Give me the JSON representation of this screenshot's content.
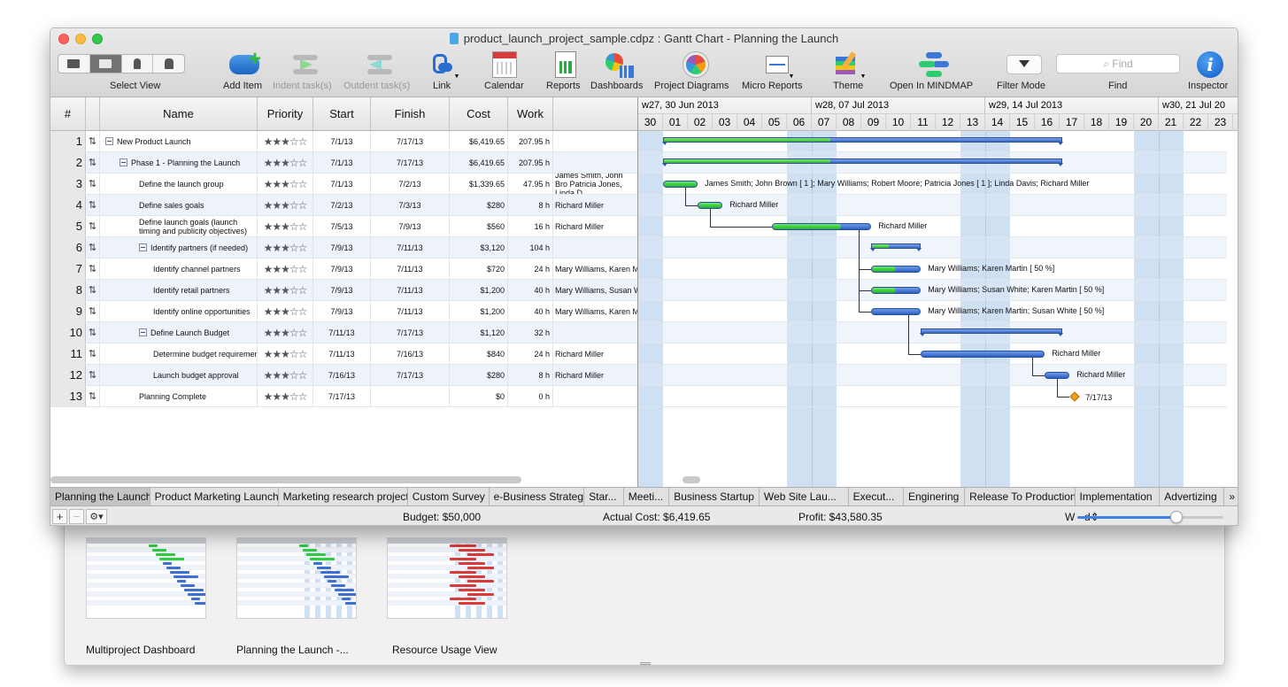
{
  "window": {
    "title": "product_launch_project_sample.cdpz : Gantt Chart - Planning the Launch"
  },
  "toolbar": {
    "select_view": "Select View",
    "add_item": "Add Item",
    "indent": "Indent task(s)",
    "outdent": "Outdent task(s)",
    "link": "Link",
    "calendar": "Calendar",
    "reports": "Reports",
    "dashboards": "Dashboards",
    "project_diagrams": "Project Diagrams",
    "micro_reports": "Micro Reports",
    "theme": "Theme",
    "open_mindmap": "Open In MINDMAP",
    "filter_mode": "Filter Mode",
    "find": "Find",
    "find_placeholder": "Find",
    "inspector": "Inspector"
  },
  "table": {
    "headers": {
      "num": "#",
      "name": "Name",
      "priority": "Priority",
      "start": "Start",
      "finish": "Finish",
      "cost": "Cost",
      "work": "Work"
    },
    "rows": [
      {
        "num": "1",
        "name": "New Product Launch",
        "level": 0,
        "group": true,
        "stars": "★★★☆☆",
        "start": "7/1/13",
        "finish": "7/17/13",
        "cost": "$6,419.65",
        "work": "207.95 h",
        "resource": ""
      },
      {
        "num": "2",
        "name": "Phase 1 - Planning the Launch",
        "level": 1,
        "group": true,
        "stars": "★★★☆☆",
        "start": "7/1/13",
        "finish": "7/17/13",
        "cost": "$6,419.65",
        "work": "207.95 h",
        "resource": ""
      },
      {
        "num": "3",
        "name": "Define the launch group",
        "level": 2,
        "group": false,
        "stars": "★★★☆☆",
        "start": "7/1/13",
        "finish": "7/2/13",
        "cost": "$1,339.65",
        "work": "47.95 h",
        "resource": "James Smith, John Bro Patricia Jones, Linda D"
      },
      {
        "num": "4",
        "name": "Define sales goals",
        "level": 2,
        "group": false,
        "stars": "★★★☆☆",
        "start": "7/2/13",
        "finish": "7/3/13",
        "cost": "$280",
        "work": "8 h",
        "resource": "Richard Miller"
      },
      {
        "num": "5",
        "name": "Define launch goals (launch timing and publicity objectives)",
        "level": 2,
        "group": false,
        "stars": "★★★☆☆",
        "start": "7/5/13",
        "finish": "7/9/13",
        "cost": "$560",
        "work": "16 h",
        "resource": "Richard Miller"
      },
      {
        "num": "6",
        "name": "Identify partners (if needed)",
        "level": 2,
        "group": true,
        "stars": "★★★☆☆",
        "start": "7/9/13",
        "finish": "7/11/13",
        "cost": "$3,120",
        "work": "104 h",
        "resource": ""
      },
      {
        "num": "7",
        "name": "Identify channel partners",
        "level": 3,
        "group": false,
        "stars": "★★★☆☆",
        "start": "7/9/13",
        "finish": "7/11/13",
        "cost": "$720",
        "work": "24 h",
        "resource": "Mary Williams, Karen M"
      },
      {
        "num": "8",
        "name": "Identify retail partners",
        "level": 3,
        "group": false,
        "stars": "★★★☆☆",
        "start": "7/9/13",
        "finish": "7/11/13",
        "cost": "$1,200",
        "work": "40 h",
        "resource": "Mary Williams, Susan W"
      },
      {
        "num": "9",
        "name": "Identify online opportunities",
        "level": 3,
        "group": false,
        "stars": "★★★☆☆",
        "start": "7/9/13",
        "finish": "7/11/13",
        "cost": "$1,200",
        "work": "40 h",
        "resource": "Mary Williams, Karen M"
      },
      {
        "num": "10",
        "name": "Define Launch Budget",
        "level": 2,
        "group": true,
        "stars": "★★★☆☆",
        "start": "7/11/13",
        "finish": "7/17/13",
        "cost": "$1,120",
        "work": "32 h",
        "resource": ""
      },
      {
        "num": "11",
        "name": "Determine budget requirements",
        "level": 3,
        "group": false,
        "stars": "★★★☆☆",
        "start": "7/11/13",
        "finish": "7/16/13",
        "cost": "$840",
        "work": "24 h",
        "resource": "Richard Miller"
      },
      {
        "num": "12",
        "name": "Launch budget approval",
        "level": 3,
        "group": false,
        "stars": "★★★☆☆",
        "start": "7/16/13",
        "finish": "7/17/13",
        "cost": "$280",
        "work": "8 h",
        "resource": "Richard Miller"
      },
      {
        "num": "13",
        "name": "Planning Complete",
        "level": 2,
        "group": false,
        "stars": "★★★☆☆",
        "start": "7/17/13",
        "finish": "",
        "cost": "$0",
        "work": "0 h",
        "resource": ""
      }
    ]
  },
  "gantt": {
    "weeks": [
      "w27, 30 Jun 2013",
      "w28, 07 Jul 2013",
      "w29, 14 Jul 2013",
      "w30, 21 Jul 20"
    ],
    "days": [
      "30",
      "01",
      "02",
      "03",
      "04",
      "05",
      "06",
      "07",
      "08",
      "09",
      "10",
      "11",
      "12",
      "13",
      "14",
      "15",
      "16",
      "17",
      "18",
      "19",
      "20",
      "21",
      "22",
      "23"
    ],
    "bars": [
      {
        "row": 0,
        "type": "summary",
        "start": 1,
        "end": 17.1,
        "progress": 0.42
      },
      {
        "row": 1,
        "type": "summary",
        "start": 1,
        "end": 17.1,
        "progress": 0.42
      },
      {
        "row": 2,
        "type": "task",
        "start": 1,
        "end": 2.4,
        "progress": 1.0,
        "label": "James Smith; John Brown [ 1 ]; Mary Williams; Robert Moore; Patricia Jones [ 1 ]; Linda Davis; Richard Miller"
      },
      {
        "row": 3,
        "type": "task",
        "start": 2.4,
        "end": 3.4,
        "progress": 1.0,
        "label": "Richard Miller"
      },
      {
        "row": 4,
        "type": "task",
        "start": 5.4,
        "end": 9.4,
        "progress": 0.7,
        "label": "Richard Miller"
      },
      {
        "row": 5,
        "type": "summary",
        "start": 9.4,
        "end": 11.4,
        "progress": 0.35
      },
      {
        "row": 6,
        "type": "task",
        "start": 9.4,
        "end": 11.4,
        "progress": 0.5,
        "label": "Mary Williams; Karen Martin [ 50 %]"
      },
      {
        "row": 7,
        "type": "task",
        "start": 9.4,
        "end": 11.4,
        "progress": 0.5,
        "label": "Mary Williams; Susan White; Karen Martin [ 50 %]"
      },
      {
        "row": 8,
        "type": "task",
        "start": 9.4,
        "end": 11.4,
        "progress": 0,
        "label": "Mary Williams; Karen Martin; Susan White [ 50 %]"
      },
      {
        "row": 9,
        "type": "summary",
        "start": 11.4,
        "end": 17.1,
        "progress": 0
      },
      {
        "row": 10,
        "type": "task",
        "start": 11.4,
        "end": 16.4,
        "progress": 0,
        "label": "Richard Miller"
      },
      {
        "row": 11,
        "type": "task",
        "start": 16.4,
        "end": 17.4,
        "progress": 0,
        "label": "Richard Miller"
      },
      {
        "row": 12,
        "type": "milestone",
        "start": 17.4,
        "label": "7/17/13"
      }
    ]
  },
  "tabs": [
    "Planning the Launch",
    "Product Marketing Launch",
    "Marketing research project",
    "Custom Survey",
    "e-Business Strategy",
    "Star...",
    "Meeti...",
    "Business Startup",
    "Web Site Lau...",
    "Execut...",
    "Enginering",
    "Release To Production",
    "Implementation",
    "Advertizing"
  ],
  "status": {
    "budget": "Budget: $50,000",
    "actual_cost": "Actual Cost: $6,419.65",
    "profit": "Profit: $43,580.35",
    "scale": "W - d",
    "zoom_level": 0.68
  },
  "views": [
    {
      "label": "Multiproject Dashboard"
    },
    {
      "label": "Planning the Launch -..."
    },
    {
      "label": "Resource Usage View"
    }
  ],
  "colors": {
    "accent": "#3b84f0",
    "task_bar": "#2c5fc4",
    "progress": "#22b322",
    "milestone": "#f0a01c",
    "weekend_shade": "#cfe0f3"
  }
}
